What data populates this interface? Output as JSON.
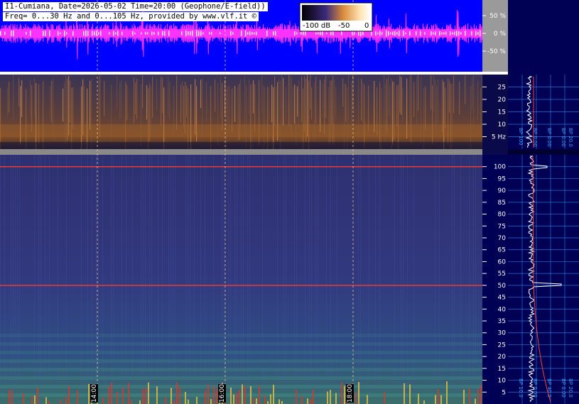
{
  "header": {
    "line1": "I1-Cumiana, Date=2026-05-02 Time=20:00 (Geophone/E-field))",
    "line2": "Freq= 0...30 Hz and 0...105 Hz, provided by www.vlf.it ©"
  },
  "colorbar": {
    "labels": [
      "-100 dB",
      "-50",
      "0"
    ]
  },
  "waveform_axis": {
    "ticks": [
      "50 %",
      "0 %",
      "-50 %"
    ]
  },
  "low_freq_axis": {
    "ticks": [
      "25",
      "20",
      "15",
      "10",
      "5 Hz"
    ]
  },
  "high_freq_axis": {
    "ticks": [
      "100",
      "95",
      "90",
      "85",
      "80",
      "75",
      "70",
      "65",
      "60",
      "55",
      "50",
      "45",
      "40",
      "35",
      "30",
      "25",
      "20",
      "15",
      "10",
      "5"
    ]
  },
  "time_labels": [
    "14:00",
    "16:00",
    "18:00"
  ],
  "spectrum_upper_labels": [
    "BP 100",
    "BP 0.00",
    "BP 0.00",
    "BP 0.00",
    "BP 20.0"
  ],
  "spectrum_lower_labels": [
    "BP 10.0",
    "BP 0.00",
    "BP 40.0",
    "BP 0.00",
    "BP 20.0"
  ],
  "colors": {
    "wave_bg": "#0000ff",
    "wave_trace": "#ff33ff",
    "spectrogram_low": "#2a2f6e",
    "spectrogram_high": "#333f8f",
    "mains_line": "#ff3b2f",
    "side_panel": "#000055",
    "grid": "#3aa0ff"
  }
}
